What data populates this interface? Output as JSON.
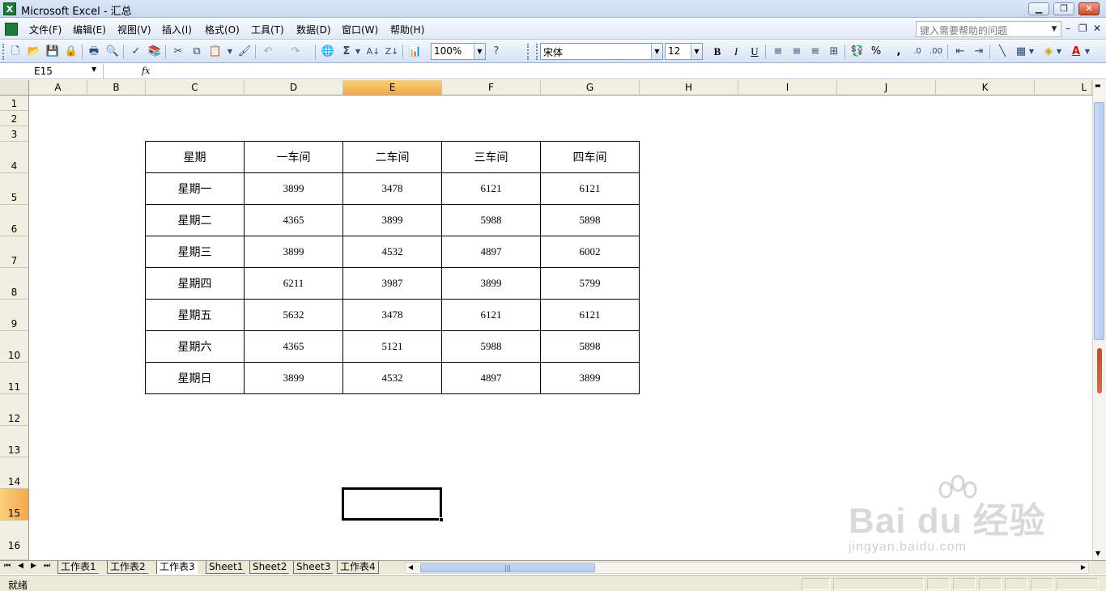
{
  "window": {
    "title": "Microsoft Excel - 汇总",
    "app_icon": "excel-icon"
  },
  "menu": {
    "items": [
      "文件(F)",
      "编辑(E)",
      "视图(V)",
      "插入(I)",
      "格式(O)",
      "工具(T)",
      "数据(D)",
      "窗口(W)",
      "帮助(H)"
    ],
    "help_placeholder": "键入需要帮助的问题"
  },
  "toolbar": {
    "zoom": "100%",
    "font_name": "宋体",
    "font_size": "12",
    "bold": "B",
    "italic": "I",
    "underline": "U",
    "percent": "%",
    "comma": ","
  },
  "formula_bar": {
    "name_box": "E15",
    "fx": "fx",
    "content": ""
  },
  "columns": [
    "A",
    "B",
    "C",
    "D",
    "E",
    "F",
    "G",
    "H",
    "I",
    "J",
    "K",
    "L"
  ],
  "selected_column": "E",
  "rows": [
    "1",
    "2",
    "3",
    "4",
    "5",
    "6",
    "7",
    "8",
    "9",
    "10",
    "11",
    "12",
    "13",
    "14",
    "15",
    "16"
  ],
  "selected_row": "15",
  "table": {
    "headers": [
      "星期",
      "一车间",
      "二车间",
      "三车间",
      "四车间"
    ],
    "rows": [
      [
        "星期一",
        "3899",
        "3478",
        "6121",
        "6121"
      ],
      [
        "星期二",
        "4365",
        "3899",
        "5988",
        "5898"
      ],
      [
        "星期三",
        "3899",
        "4532",
        "4897",
        "6002"
      ],
      [
        "星期四",
        "6211",
        "3987",
        "3899",
        "5799"
      ],
      [
        "星期五",
        "5632",
        "3478",
        "6121",
        "6121"
      ],
      [
        "星期六",
        "4365",
        "5121",
        "5988",
        "5898"
      ],
      [
        "星期日",
        "3899",
        "4532",
        "4897",
        "3899"
      ]
    ]
  },
  "sheets": {
    "tabs": [
      "工作表1",
      "工作表2",
      "工作表3",
      "Sheet1",
      "Sheet2",
      "Sheet3",
      "工作表4"
    ],
    "active": "工作表3"
  },
  "status": {
    "text": "就绪"
  },
  "watermark": {
    "main": "Bai du 经验",
    "sub": "jingyan.baidu.com"
  }
}
